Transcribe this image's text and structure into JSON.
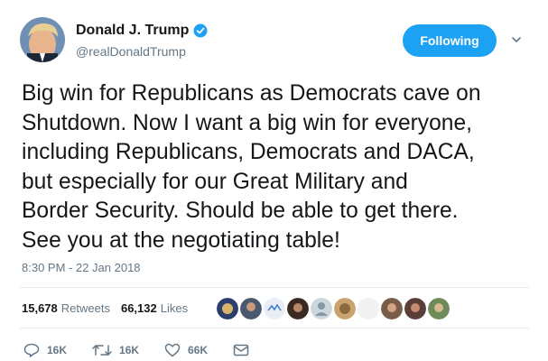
{
  "author": {
    "display_name": "Donald J. Trump",
    "handle": "@realDonaldTrump",
    "verified": true,
    "avatar_icon": "avatar-photo"
  },
  "follow_button": {
    "label": "Following",
    "color": "#1da1f2"
  },
  "menu_icon": "chevron-down-icon",
  "tweet": {
    "text": "Big win for Republicans as Democrats cave on\nShutdown. Now I want a big win for everyone,\nincluding Republicans, Democrats and DACA,\nbut especially for our Great Military and\nBorder Security. Should be able to get there.\nSee you at the negotiating table!",
    "timestamp": "8:30 PM - 22 Jan 2018"
  },
  "stats": {
    "retweets_count": "15,678",
    "retweets_label": "Retweets",
    "likes_count": "66,132",
    "likes_label": "Likes",
    "likers_faces": 10
  },
  "actions": {
    "reply_count": "16K",
    "retweet_count": "16K",
    "like_count": "66K",
    "message_icon": "envelope-icon"
  },
  "colors": {
    "accent": "#1da1f2",
    "secondary_text": "#657786",
    "primary_text": "#14171a",
    "divider": "#e6ecf0"
  }
}
